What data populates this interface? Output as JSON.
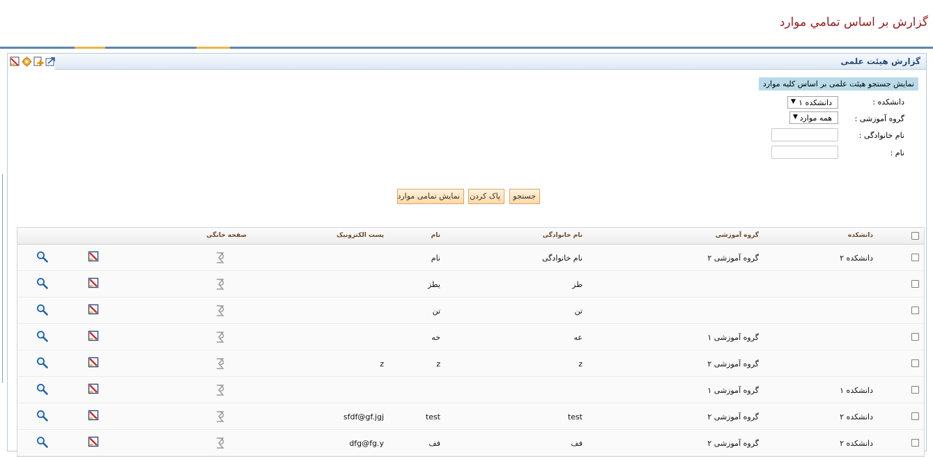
{
  "page": {
    "title": "گزارش بر اساس تمامي موارد"
  },
  "portlet": {
    "title": "گزارش هیئت علمی",
    "tools": [
      "export-icon",
      "add-icon",
      "settings-icon",
      "minimize-icon"
    ]
  },
  "search": {
    "box_title": "نمایش جستجو هیئت علمی بر اساس کلیه موارد",
    "faculty_label": "دانشکده :",
    "faculty_value": "دانشکده ۱",
    "group_label": "گروه آموزشی :",
    "group_value": "همه موارد",
    "lastname_label": "نام خانوادگی :",
    "lastname_value": "",
    "firstname_label": "نام :",
    "firstname_value": ""
  },
  "buttons": {
    "search": "جستجو",
    "clear": "پاک کردن",
    "show_all": "نمایش تمامی موارد"
  },
  "grid": {
    "headers": {
      "faculty": "دانشکده",
      "group": "گروه آموزشی",
      "lastname": "نام خانوادگی",
      "firstname": "نام",
      "email": "پست الکترونیک",
      "homepage": "صفحه خانگی"
    },
    "rows": [
      {
        "faculty": "دانشکده ۲",
        "group": "گروه آموزشی ۲",
        "lastname": "نام خانوادگی",
        "firstname": "نام",
        "email": ""
      },
      {
        "faculty": "",
        "group": "",
        "lastname": "طز",
        "firstname": "یطز",
        "email": ""
      },
      {
        "faculty": "",
        "group": "",
        "lastname": "تن",
        "firstname": "تن",
        "email": ""
      },
      {
        "faculty": "",
        "group": "گروه آموزشی ۱",
        "lastname": "عه",
        "firstname": "خه",
        "email": ""
      },
      {
        "faculty": "",
        "group": "گروه آموزشی ۲",
        "lastname": "z",
        "firstname": "z",
        "email": "z"
      },
      {
        "faculty": "دانشکده ۱",
        "group": "گروه آموزشی ۱",
        "lastname": "",
        "firstname": "",
        "email": ""
      },
      {
        "faculty": "دانشکده ۲",
        "group": "گروه آموزشی ۲",
        "lastname": "test",
        "firstname": "test",
        "email": "sfdf@gf.jgj"
      },
      {
        "faculty": "دانشکده ۲",
        "group": "گروه آموزشی ۲",
        "lastname": "فف",
        "firstname": "فف",
        "email": "dfg@fg.y"
      }
    ]
  },
  "colors": {
    "title": "#9a1a1a",
    "accent_rule": "#5f83ad",
    "tab_marker": "#e9b54a",
    "portlet_title": "#2a4d78",
    "search_box": "#b9dbe9",
    "button_fill": "#ffd9a6"
  }
}
